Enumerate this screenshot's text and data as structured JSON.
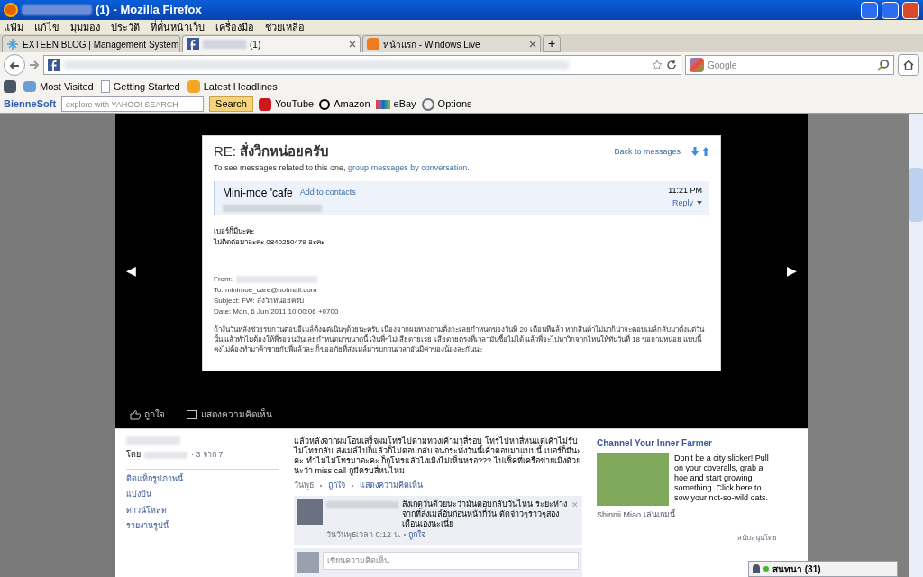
{
  "window": {
    "title": "(1) - Mozilla Firefox"
  },
  "menu": [
    "แฟ้ม",
    "แก้ไข",
    "มุมมอง",
    "ประวัติ",
    "ที่คั่นหน้าเว็บ",
    "เครื่องมือ",
    "ช่วยเหลือ"
  ],
  "tabs": [
    {
      "label": "EXTEEN BLOG | Management System",
      "selected": false,
      "kind": "exteen"
    },
    {
      "label": "(1)",
      "selected": true,
      "kind": "facebook"
    },
    {
      "label": "หน้าแรก - Windows Live",
      "selected": false,
      "kind": "live"
    }
  ],
  "new_tab": "+",
  "search": {
    "placeholder": "Google"
  },
  "bookmarks": [
    {
      "label": "Most Visited",
      "kind": "star"
    },
    {
      "label": "Getting Started",
      "kind": "page"
    },
    {
      "label": "Latest Headlines",
      "kind": "feed"
    }
  ],
  "toolbar": {
    "brand": "BienneSoft",
    "placeholder": "explore with YAHOO! SEARCH",
    "button": "Search",
    "links": [
      {
        "label": "YouTube",
        "kind": "youtube"
      },
      {
        "label": "Amazon",
        "kind": "amazon"
      },
      {
        "label": "eBay",
        "kind": "ebay"
      },
      {
        "label": "Options",
        "kind": "options"
      }
    ]
  },
  "viewer": {
    "prev": "◀",
    "next": "▶",
    "email": {
      "prefix": "RE:",
      "subject": "สั่งวิกหน่อยครับ",
      "hint": "To see messages related to this one,",
      "hint_link": "group messages by conversation.",
      "back": "Back to messages",
      "sender": "Mini-moe 'cafe",
      "add": "Add to contacts",
      "time": "11:21 PM",
      "reply": "Reply",
      "body": [
        "เบอร์ก็มีนะคะ",
        "ไม่ติดต่อมาละคะ  0840250479 อะคะ"
      ],
      "headers": [
        "From:",
        "To: minimoe_care@notmail.com",
        "Subject: FW: สั่งวิกหน่อยครับ",
        "Date: Mon, 6 Jun 2011 10:00:06 +0700"
      ],
      "quote": "ถ้างั้นวันหลังช่วยรบกวนตอบอีเมล์ตั้งแต่เนิ่นๆด้วยนะครับ เนื่องจากผมทวงถามตั้งกะเลยกำหนดของวันที่ 20 เดือนที่แล้ว หากสินค้าไม่มาก็น่าจะตอบเมล์กลับมาตั้งแต่วันนั้น แล้วทำไมต้องให้พี่รอจนมันเลยกำหนดมาขนาดนี้ เงินพี่ๆไม่เสียดายเรย เสียดายตรงที่เวลามันซื้อไม่ได้ แล้วพี่จะไปหาวิกจากไหนให้ทันวันที่ 18 ขอถามหน่อย แบบนี้คงไม่ต้องทำมาค้าขายกับพี่แล้วละ ก็ขออภัยที่ส่งเมล์มารบกวนเวลาอันมีค่าของน้องละกันนะ"
    },
    "actions": [
      {
        "label": "ถูกใจ",
        "kind": "like"
      },
      {
        "label": "แสดงความคิดเห็น",
        "kind": "comment"
      }
    ]
  },
  "info": {
    "by": "โดย",
    "count": "· 3 จาก 7",
    "links": [
      "ติดแท็กรูปภาพนี้",
      "แบ่งปัน",
      "ดาวน์โหลด",
      "รายงานรูปนี้"
    ]
  },
  "post": {
    "text": "แล้วหลังจากผมโอนเสร็จผมโทรไปตามทวงเค้ามาสี่รอบ โทรไปหาสี่หนแต่เค้าไม่รับ ไม่โทรกลับ ส่งเมล์ไปก็แล้วก็ไม่ตอบกลับ จนกระทั่งวันนี้เค้าตอบมาแบบนี้ เบอร์ก็มีนะคะ ทำไมไม่โทรมาอะคะ ก็กูโทรแล้วไงเมิงไม่เห็นหรอ??? ไปเช็คที่เครือข่ายเมิงด้วยนะว่า miss call กูมีครบสี่หนไหม",
    "day": "วันพุธ",
    "like": "ถูกใจ",
    "comment": "แสดงความคิดเห็น"
  },
  "comment": {
    "text": "สังเกตุวันด้วยนะว่ามันตอบกลับวันไหน ระยะห่างจากที่ส่งเมล์อันก่อนหน้ากี่วัน ตัดจ่าวๆราวๆสองเดือนเองนะเนี่ย",
    "time": "วันวันพุธเวลา 0:12 น.",
    "like": "ถูกใจ",
    "close": "✕"
  },
  "comment_box": {
    "placeholder": "เขียนความคิดเห็น..."
  },
  "ad": {
    "title": "Channel Your Inner Farmer",
    "text": "Don't be a city slicker! Pull on your coveralls, grab a hoe and start growing something. Click here to sow your not-so-wild oats.",
    "caption": "Shinnii Miao เล่นเกมนี้",
    "sponsor": "สนับสนุนโดย"
  },
  "chat": {
    "label": "สนทนา (31)"
  }
}
